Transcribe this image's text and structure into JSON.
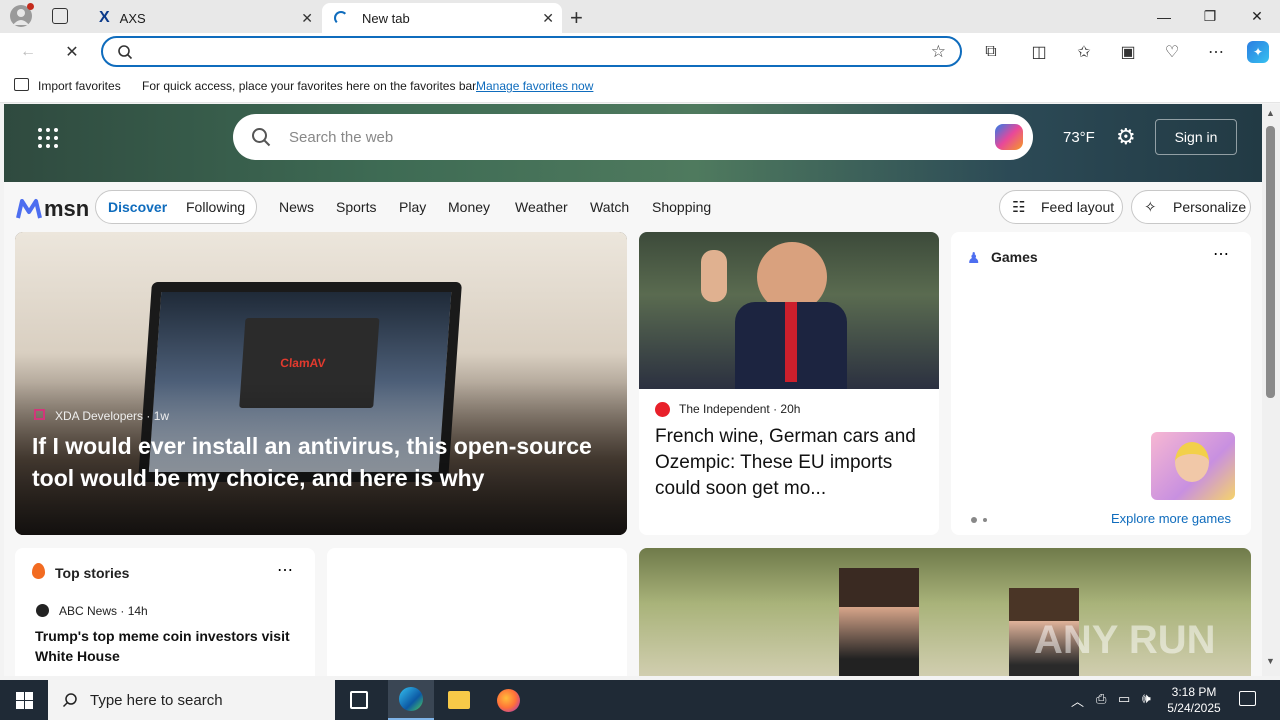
{
  "browser": {
    "tabs": [
      {
        "label": "AXS"
      },
      {
        "label": "New tab"
      }
    ],
    "favorites_bar": {
      "import_label": "Import favorites",
      "hint": "For quick access, place your favorites here on the favorites bar.",
      "manage_link": "Manage favorites now"
    }
  },
  "msn": {
    "search_placeholder": "Search the web",
    "temperature": "73°F",
    "sign_in": "Sign in",
    "logo": "msn",
    "modes": [
      "Discover",
      "Following"
    ],
    "nav": [
      "News",
      "Sports",
      "Play",
      "Money",
      "Weather",
      "Watch",
      "Shopping"
    ],
    "feed_layout": "Feed layout",
    "personalize": "Personalize"
  },
  "cards": {
    "main": {
      "source": "XDA Developers",
      "age": "1w",
      "headline": "If I would ever install an antivirus, this open-source tool would be my choice, and here is why",
      "screen_label": "ClamAV"
    },
    "second": {
      "source": "The Independent",
      "age": "20h",
      "headline": "French wine, German cars and Ozempic: These EU imports could soon get mo..."
    },
    "games": {
      "title": "Games",
      "explore": "Explore more games"
    },
    "top_stories": {
      "title": "Top stories",
      "source": "ABC News",
      "age": "14h",
      "headline": "Trump's top meme coin investors visit White House"
    }
  },
  "watermark": "ANY RUN",
  "taskbar": {
    "search_placeholder": "Type here to search",
    "time": "3:18 PM",
    "date": "5/24/2025"
  }
}
